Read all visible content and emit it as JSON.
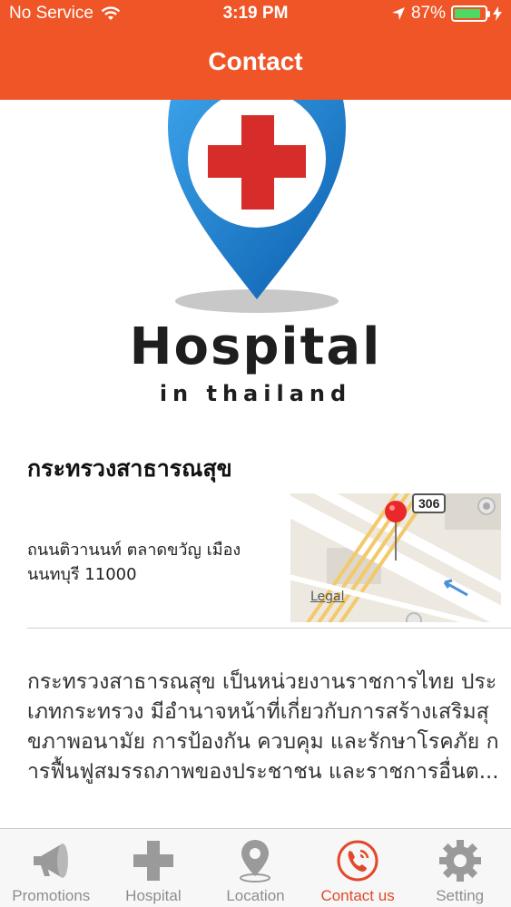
{
  "status_bar": {
    "carrier": "No Service",
    "time": "3:19 PM",
    "battery": "87%",
    "battery_level": 0.87
  },
  "nav": {
    "title": "Contact"
  },
  "logo": {
    "word": "Hospital",
    "tagline": "in thailand"
  },
  "hospital": {
    "name": "กระทรวงสาธารณสุข",
    "address": "ถนนติวานนท์ ตลาดขวัญ เมือง นนทบุรี 11000",
    "map": {
      "legal": "Legal",
      "route_shield": "306"
    },
    "description": "กระทรวงสาธารณสุข เป็นหน่วยงานราชการไทย ประเภทกระทรวง มีอำนาจหน้าที่เกี่ยวกับการสร้างเสริมสุขภาพอนามัย การป้องกัน ควบคุม และรักษาโรคภัย การฟื้นฟูสมรรถภาพของประชาชน และราชการอื่นต..."
  },
  "tabs": [
    {
      "label": "Promotions",
      "icon": "megaphone-icon",
      "active": false
    },
    {
      "label": "Hospital",
      "icon": "cross-icon",
      "active": false
    },
    {
      "label": "Location",
      "icon": "location-pin-icon",
      "active": false
    },
    {
      "label": "Contact us",
      "icon": "phone-icon",
      "active": true
    },
    {
      "label": "Setting",
      "icon": "gear-icon",
      "active": false
    }
  ],
  "colors": {
    "accent": "#ef5527",
    "active_tab": "#e2492a",
    "inactive_tab": "#8e8e8e",
    "pin_blue": "#1a7fd0",
    "cross_red": "#d62d2a"
  }
}
